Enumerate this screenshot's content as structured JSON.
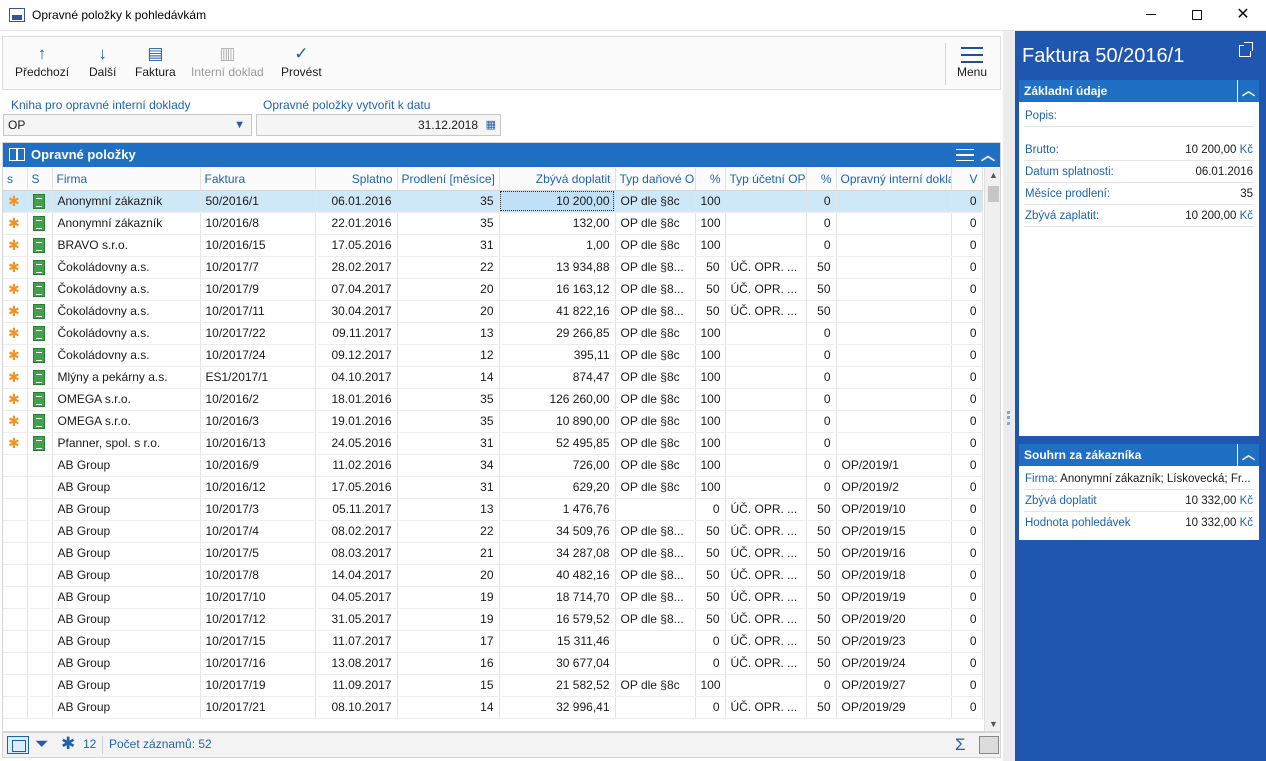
{
  "window": {
    "title": "Opravné položky k pohledávkám"
  },
  "toolbar": {
    "prev": "Předchozí",
    "next": "Další",
    "invoice": "Faktura",
    "internal_doc": "Interní doklad",
    "execute": "Provést",
    "menu": "Menu"
  },
  "fields": {
    "book_label": "Kniha pro opravné interní doklady",
    "book_value": "OP",
    "date_label": "Opravné položky vytvořit k datu",
    "date_value": "31.12.2018"
  },
  "grid": {
    "title": "Opravné položky",
    "columns": [
      "s",
      "S",
      "Firma",
      "Faktura",
      "Splatno",
      "Prodlení [měsíce]",
      "Zbývá doplatit",
      "Typ daňové O",
      "%",
      "Typ účetní OP",
      "%",
      "Opravný interní dokla",
      "V"
    ],
    "rows": [
      {
        "s": "✱",
        "S": "doc",
        "firma": "Anonymní zákazník",
        "faktura": "50/2016/1",
        "splatno": "06.01.2016",
        "prodleni": "35",
        "zbyva": "10 200,00",
        "typ_dan": "OP dle §8c",
        "p1": "100",
        "typ_uc": "",
        "p2": "0",
        "op_doc": "",
        "v": "0"
      },
      {
        "s": "✱",
        "S": "doc",
        "firma": "Anonymní zákazník",
        "faktura": "10/2016/8",
        "splatno": "22.01.2016",
        "prodleni": "35",
        "zbyva": "132,00",
        "typ_dan": "OP dle §8c",
        "p1": "100",
        "typ_uc": "",
        "p2": "0",
        "op_doc": "",
        "v": "0"
      },
      {
        "s": "✱",
        "S": "doc",
        "firma": "BRAVO s.r.o.",
        "faktura": "10/2016/15",
        "splatno": "17.05.2016",
        "prodleni": "31",
        "zbyva": "1,00",
        "typ_dan": "OP dle §8c",
        "p1": "100",
        "typ_uc": "",
        "p2": "0",
        "op_doc": "",
        "v": "0"
      },
      {
        "s": "✱",
        "S": "doc",
        "firma": "Čokoládovny a.s.",
        "faktura": "10/2017/7",
        "splatno": "28.02.2017",
        "prodleni": "22",
        "zbyva": "13 934,88",
        "typ_dan": "OP dle §8...",
        "p1": "50",
        "typ_uc": "ÚČ. OPR. ...",
        "p2": "50",
        "op_doc": "",
        "v": "0"
      },
      {
        "s": "✱",
        "S": "doc",
        "firma": "Čokoládovny a.s.",
        "faktura": "10/2017/9",
        "splatno": "07.04.2017",
        "prodleni": "20",
        "zbyva": "16 163,12",
        "typ_dan": "OP dle §8...",
        "p1": "50",
        "typ_uc": "ÚČ. OPR. ...",
        "p2": "50",
        "op_doc": "",
        "v": "0"
      },
      {
        "s": "✱",
        "S": "doc",
        "firma": "Čokoládovny a.s.",
        "faktura": "10/2017/11",
        "splatno": "30.04.2017",
        "prodleni": "20",
        "zbyva": "41 822,16",
        "typ_dan": "OP dle §8...",
        "p1": "50",
        "typ_uc": "ÚČ. OPR. ...",
        "p2": "50",
        "op_doc": "",
        "v": "0"
      },
      {
        "s": "✱",
        "S": "doc",
        "firma": "Čokoládovny a.s.",
        "faktura": "10/2017/22",
        "splatno": "09.11.2017",
        "prodleni": "13",
        "zbyva": "29 266,85",
        "typ_dan": "OP dle §8c",
        "p1": "100",
        "typ_uc": "",
        "p2": "0",
        "op_doc": "",
        "v": "0"
      },
      {
        "s": "✱",
        "S": "doc",
        "firma": "Čokoládovny a.s.",
        "faktura": "10/2017/24",
        "splatno": "09.12.2017",
        "prodleni": "12",
        "zbyva": "395,11",
        "typ_dan": "OP dle §8c",
        "p1": "100",
        "typ_uc": "",
        "p2": "0",
        "op_doc": "",
        "v": "0"
      },
      {
        "s": "✱",
        "S": "doc",
        "firma": "Mlýny a pekárny a.s.",
        "faktura": "ES1/2017/1",
        "splatno": "04.10.2017",
        "prodleni": "14",
        "zbyva": "874,47",
        "typ_dan": "OP dle §8c",
        "p1": "100",
        "typ_uc": "",
        "p2": "0",
        "op_doc": "",
        "v": "0"
      },
      {
        "s": "✱",
        "S": "doc",
        "firma": "OMEGA s.r.o.",
        "faktura": "10/2016/2",
        "splatno": "18.01.2016",
        "prodleni": "35",
        "zbyva": "126 260,00",
        "typ_dan": "OP dle §8c",
        "p1": "100",
        "typ_uc": "",
        "p2": "0",
        "op_doc": "",
        "v": "0"
      },
      {
        "s": "✱",
        "S": "doc",
        "firma": "OMEGA s.r.o.",
        "faktura": "10/2016/3",
        "splatno": "19.01.2016",
        "prodleni": "35",
        "zbyva": "10 890,00",
        "typ_dan": "OP dle §8c",
        "p1": "100",
        "typ_uc": "",
        "p2": "0",
        "op_doc": "",
        "v": "0"
      },
      {
        "s": "✱",
        "S": "doc",
        "firma": "Pfanner, spol. s r.o.",
        "faktura": "10/2016/13",
        "splatno": "24.05.2016",
        "prodleni": "31",
        "zbyva": "52 495,85",
        "typ_dan": "OP dle §8c",
        "p1": "100",
        "typ_uc": "",
        "p2": "0",
        "op_doc": "",
        "v": "0"
      },
      {
        "s": "",
        "S": "",
        "firma": "AB Group",
        "faktura": "10/2016/9",
        "splatno": "11.02.2016",
        "prodleni": "34",
        "zbyva": "726,00",
        "typ_dan": "OP dle §8c",
        "p1": "100",
        "typ_uc": "",
        "p2": "0",
        "op_doc": "OP/2019/1",
        "v": "0"
      },
      {
        "s": "",
        "S": "",
        "firma": "AB Group",
        "faktura": "10/2016/12",
        "splatno": "17.05.2016",
        "prodleni": "31",
        "zbyva": "629,20",
        "typ_dan": "OP dle §8c",
        "p1": "100",
        "typ_uc": "",
        "p2": "0",
        "op_doc": "OP/2019/2",
        "v": "0"
      },
      {
        "s": "",
        "S": "",
        "firma": "AB Group",
        "faktura": "10/2017/3",
        "splatno": "05.11.2017",
        "prodleni": "13",
        "zbyva": "1 476,76",
        "typ_dan": "",
        "p1": "0",
        "typ_uc": "ÚČ. OPR. ...",
        "p2": "50",
        "op_doc": "OP/2019/10",
        "v": "0"
      },
      {
        "s": "",
        "S": "",
        "firma": "AB Group",
        "faktura": "10/2017/4",
        "splatno": "08.02.2017",
        "prodleni": "22",
        "zbyva": "34 509,76",
        "typ_dan": "OP dle §8...",
        "p1": "50",
        "typ_uc": "ÚČ. OPR. ...",
        "p2": "50",
        "op_doc": "OP/2019/15",
        "v": "0"
      },
      {
        "s": "",
        "S": "",
        "firma": "AB Group",
        "faktura": "10/2017/5",
        "splatno": "08.03.2017",
        "prodleni": "21",
        "zbyva": "34 287,08",
        "typ_dan": "OP dle §8...",
        "p1": "50",
        "typ_uc": "ÚČ. OPR. ...",
        "p2": "50",
        "op_doc": "OP/2019/16",
        "v": "0"
      },
      {
        "s": "",
        "S": "",
        "firma": "AB Group",
        "faktura": "10/2017/8",
        "splatno": "14.04.2017",
        "prodleni": "20",
        "zbyva": "40 482,16",
        "typ_dan": "OP dle §8...",
        "p1": "50",
        "typ_uc": "ÚČ. OPR. ...",
        "p2": "50",
        "op_doc": "OP/2019/18",
        "v": "0"
      },
      {
        "s": "",
        "S": "",
        "firma": "AB Group",
        "faktura": "10/2017/10",
        "splatno": "04.05.2017",
        "prodleni": "19",
        "zbyva": "18 714,70",
        "typ_dan": "OP dle §8...",
        "p1": "50",
        "typ_uc": "ÚČ. OPR. ...",
        "p2": "50",
        "op_doc": "OP/2019/19",
        "v": "0"
      },
      {
        "s": "",
        "S": "",
        "firma": "AB Group",
        "faktura": "10/2017/12",
        "splatno": "31.05.2017",
        "prodleni": "19",
        "zbyva": "16 579,52",
        "typ_dan": "OP dle §8...",
        "p1": "50",
        "typ_uc": "ÚČ. OPR. ...",
        "p2": "50",
        "op_doc": "OP/2019/20",
        "v": "0"
      },
      {
        "s": "",
        "S": "",
        "firma": "AB Group",
        "faktura": "10/2017/15",
        "splatno": "11.07.2017",
        "prodleni": "17",
        "zbyva": "15 311,46",
        "typ_dan": "",
        "p1": "0",
        "typ_uc": "ÚČ. OPR. ...",
        "p2": "50",
        "op_doc": "OP/2019/23",
        "v": "0"
      },
      {
        "s": "",
        "S": "",
        "firma": "AB Group",
        "faktura": "10/2017/16",
        "splatno": "13.08.2017",
        "prodleni": "16",
        "zbyva": "30 677,04",
        "typ_dan": "",
        "p1": "0",
        "typ_uc": "ÚČ. OPR. ...",
        "p2": "50",
        "op_doc": "OP/2019/24",
        "v": "0"
      },
      {
        "s": "",
        "S": "",
        "firma": "AB Group",
        "faktura": "10/2017/19",
        "splatno": "11.09.2017",
        "prodleni": "15",
        "zbyva": "21 582,52",
        "typ_dan": "OP dle §8c",
        "p1": "100",
        "typ_uc": "",
        "p2": "0",
        "op_doc": "OP/2019/27",
        "v": "0"
      },
      {
        "s": "",
        "S": "",
        "firma": "AB Group",
        "faktura": "10/2017/21",
        "splatno": "08.10.2017",
        "prodleni": "14",
        "zbyva": "32 996,41",
        "typ_dan": "",
        "p1": "0",
        "typ_uc": "ÚČ. OPR. ...",
        "p2": "50",
        "op_doc": "OP/2019/29",
        "v": "0"
      }
    ]
  },
  "status": {
    "marked_count": "12",
    "records_label": "Počet záznamů: 52"
  },
  "side_panel": {
    "title": "Faktura 50/2016/1",
    "basic": {
      "header": "Základní údaje",
      "description_label": "Popis:",
      "gross_label": "Brutto:",
      "gross_value": "10 200,00",
      "due_label": "Datum splatnosti:",
      "due_value": "06.01.2016",
      "delay_label": "Měsíce prodlení:",
      "delay_value": "35",
      "remaining_label": "Zbývá zaplatit:",
      "remaining_value": "10 200,00",
      "currency": "Kč"
    },
    "summary": {
      "header": "Souhrn za zákazníka",
      "firm_label": "Firma:",
      "firm_value": "Anonymní zákazník; Lískovecká; Fr...",
      "remaining_label": "Zbývá doplatit",
      "remaining_value": "10 332,00",
      "receivables_label": "Hodnota pohledávek",
      "receivables_value": "10 332,00",
      "currency": "Kč"
    }
  },
  "colors": {
    "accent": "#1f6fc4",
    "panel": "#1f56b0",
    "star": "#f39323",
    "doc": "#3fa24a",
    "selected_row": "#cfe8f8"
  }
}
